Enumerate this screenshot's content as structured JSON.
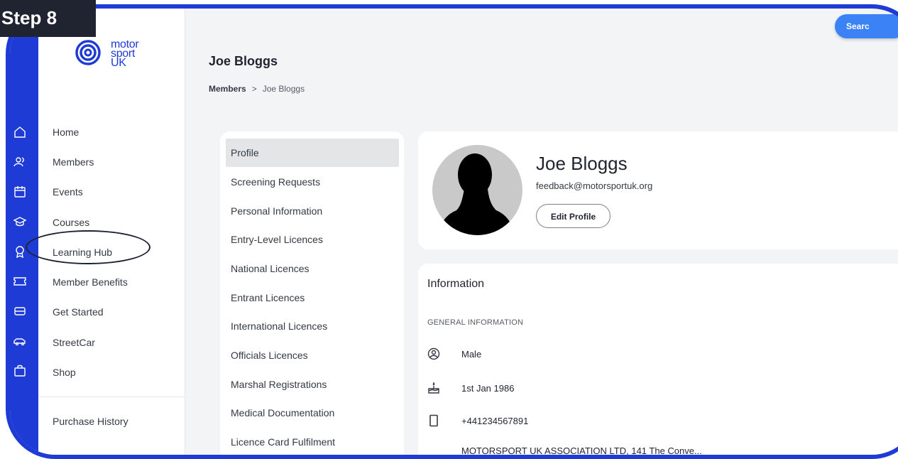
{
  "step_badge": "Step 8",
  "logo": {
    "line1": "motor",
    "line2": "sport",
    "line3": "UK"
  },
  "sidebar": {
    "items": [
      {
        "label": "Home",
        "icon": "home-icon"
      },
      {
        "label": "Members",
        "icon": "members-icon"
      },
      {
        "label": "Events",
        "icon": "calendar-icon"
      },
      {
        "label": "Courses",
        "icon": "graduation-cap-icon"
      },
      {
        "label": "Learning Hub",
        "icon": "award-icon"
      },
      {
        "label": "Member Benefits",
        "icon": "ticket-icon"
      },
      {
        "label": "Get Started",
        "icon": "car-front-icon"
      },
      {
        "label": "StreetCar",
        "icon": "car-side-icon"
      },
      {
        "label": "Shop",
        "icon": "shopping-bag-icon"
      }
    ],
    "footer_item": "Purchase History"
  },
  "header": {
    "title": "Joe Bloggs",
    "breadcrumb_root": "Members",
    "breadcrumb_sep": ">",
    "breadcrumb_current": "Joe Bloggs",
    "search_label": "Searc"
  },
  "tabs": [
    "Profile",
    "Screening Requests",
    "Personal Information",
    "Entry-Level Licences",
    "National Licences",
    "Entrant Licences",
    "International Licences",
    "Officials Licences",
    "Marshal Registrations",
    "Medical Documentation",
    "Licence Card Fulfilment"
  ],
  "active_tab": "Profile",
  "profile": {
    "name": "Joe Bloggs",
    "email": "feedback@motorsportuk.org",
    "edit_label": "Edit Profile"
  },
  "information": {
    "title": "Information",
    "section": "GENERAL INFORMATION",
    "gender": "Male",
    "dob": "1st Jan 1986",
    "phone": "+441234567891",
    "address": "MOTORSPORT UK ASSOCIATION LTD, 141 The Conve..."
  },
  "colors": {
    "accent": "#1f3bd6",
    "badge": "#1f2430",
    "search": "#3b82f6"
  }
}
